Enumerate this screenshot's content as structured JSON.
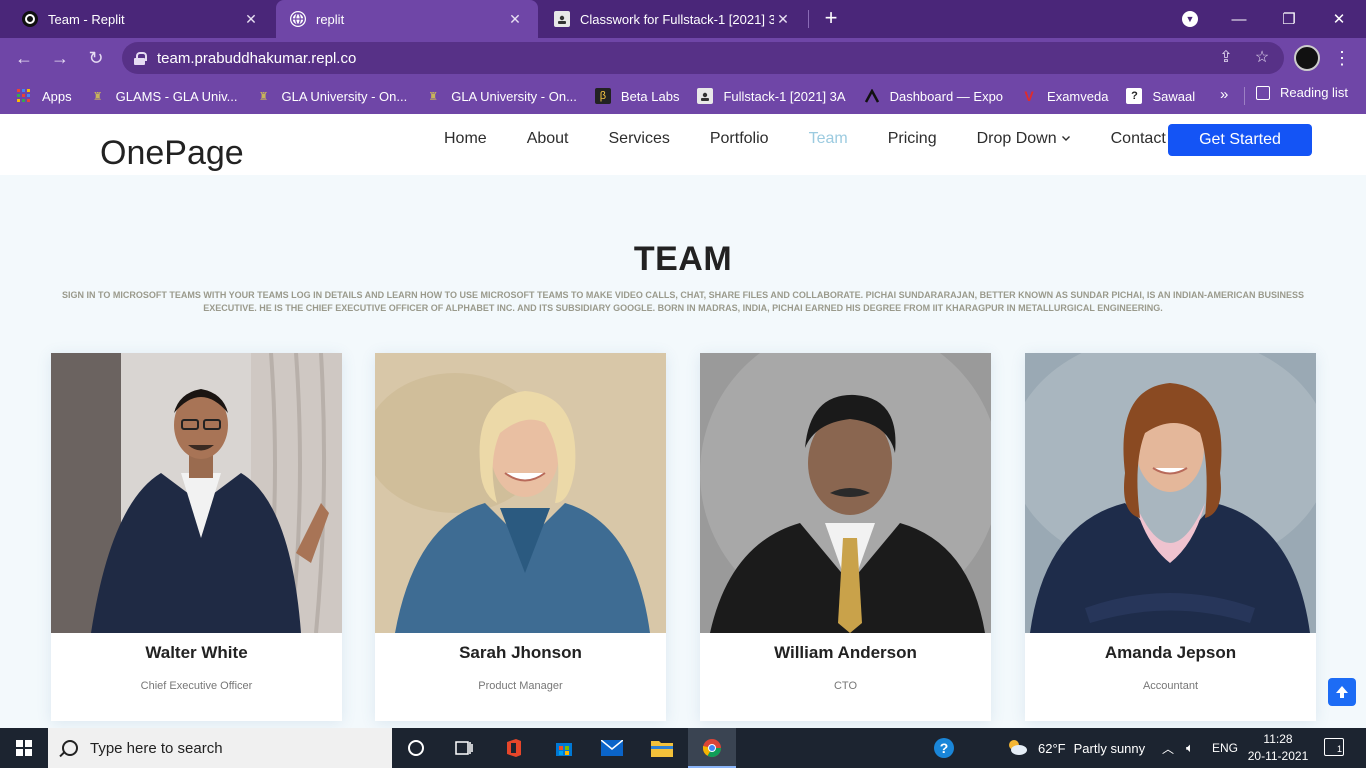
{
  "browser": {
    "tabs": [
      {
        "title": "Team - Replit",
        "active": false
      },
      {
        "title": "replit",
        "active": true
      },
      {
        "title": "Classwork for Fullstack-1 [2021] 3",
        "active": false
      }
    ],
    "new_tab": "+",
    "url": "team.prabuddhakumar.repl.co",
    "bookmarks": [
      {
        "label": "Apps",
        "icon": "apps-grid-icon"
      },
      {
        "label": "GLAMS - GLA Univ...",
        "icon": "gla-logo-icon"
      },
      {
        "label": "GLA University - On...",
        "icon": "gla-logo-icon"
      },
      {
        "label": "GLA University - On...",
        "icon": "gla-logo-icon"
      },
      {
        "label": "Beta Labs",
        "icon": "beta-labs-icon"
      },
      {
        "label": "Fullstack-1 [2021] 3A",
        "icon": "classroom-icon"
      },
      {
        "label": "Dashboard — Expo",
        "icon": "expo-icon"
      },
      {
        "label": "Examveda",
        "icon": "examveda-icon"
      },
      {
        "label": "Sawaal",
        "icon": "sawaal-icon"
      }
    ],
    "bookmarks_more": "»",
    "reading_list": "Reading list"
  },
  "site": {
    "logo": "OnePage",
    "nav": [
      {
        "label": "Home",
        "active": false
      },
      {
        "label": "About",
        "active": false
      },
      {
        "label": "Services",
        "active": false
      },
      {
        "label": "Portfolio",
        "active": false
      },
      {
        "label": "Team",
        "active": true
      },
      {
        "label": "Pricing",
        "active": false
      },
      {
        "label": "Drop Down",
        "active": false
      },
      {
        "label": "Contact",
        "active": false
      }
    ],
    "cta": "Get Started",
    "accent": "#1454f5",
    "active_nav_color": "#9ccbe0"
  },
  "team": {
    "title": "TEAM",
    "description": "SIGN IN TO MICROSOFT TEAMS WITH YOUR TEAMS LOG IN DETAILS AND LEARN HOW TO USE MICROSOFT TEAMS TO MAKE VIDEO CALLS, CHAT, SHARE FILES AND COLLABORATE. PICHAI SUNDARARAJAN, BETTER KNOWN AS SUNDAR PICHAI, IS AN INDIAN-AMERICAN BUSINESS EXECUTIVE. HE IS THE CHIEF EXECUTIVE OFFICER OF ALPHABET INC. AND ITS SUBSIDIARY GOOGLE. BORN IN MADRAS, INDIA, PICHAI EARNED HIS DEGREE FROM IIT KHARAGPUR IN METALLURGICAL ENGINEERING.",
    "members": [
      {
        "name": "Walter White",
        "role": "Chief Executive Officer"
      },
      {
        "name": "Sarah Jhonson",
        "role": "Product Manager"
      },
      {
        "name": "William Anderson",
        "role": "CTO"
      },
      {
        "name": "Amanda Jepson",
        "role": "Accountant"
      }
    ]
  },
  "taskbar": {
    "search_placeholder": "Type here to search",
    "weather_temp": "62°F",
    "weather_text": "Partly sunny",
    "language": "ENG",
    "time": "11:28",
    "date": "20-11-2021",
    "notifications": "1"
  }
}
